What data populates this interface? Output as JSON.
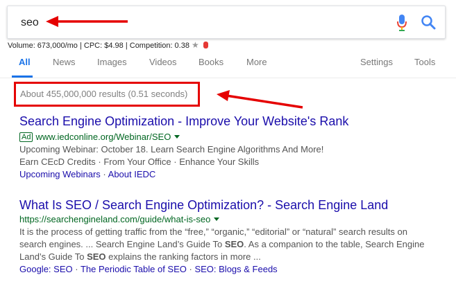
{
  "search": {
    "query": "seo"
  },
  "metrics": {
    "volume": "Volume: 673,000/mo",
    "cpc": "CPC: $4.98",
    "competition": "Competition: 0.38"
  },
  "tabs": [
    {
      "label": "All",
      "active": true
    },
    {
      "label": "News"
    },
    {
      "label": "Images"
    },
    {
      "label": "Videos"
    },
    {
      "label": "Books"
    },
    {
      "label": "More"
    },
    {
      "label": "Settings"
    },
    {
      "label": "Tools"
    }
  ],
  "result_stats": "About 455,000,000 results (0.51 seconds)",
  "results": [
    {
      "title": "Search Engine Optimization - Improve Your Website's Rank",
      "ad_label": "Ad",
      "url": "www.iedconline.org/Webinar/SEO",
      "lines": [
        "Upcoming Webinar: October 18. Learn Search Engine Algorithms And More!",
        "Earn CEcD Credits · From Your Office · Enhance Your Skills"
      ],
      "sitelinks": [
        "Upcoming Webinars",
        "About IEDC"
      ]
    },
    {
      "title": "What Is SEO / Search Engine Optimization? - Search Engine Land",
      "url": "https://searchengineland.com/guide/what-is-seo",
      "snippet": [
        "It is the process of getting traffic from the “free,” “organic,” “editorial” or “natural” search results on",
        "search engines. ... Search Engine Land’s Guide To ",
        "SEO",
        ". As a companion to the table, Search Engine",
        "Land’s Guide To ",
        "SEO",
        " explains the ranking factors in more ..."
      ],
      "sitelinks": [
        "Google: SEO",
        "The Periodic Table of SEO",
        "SEO: Blogs & Feeds"
      ]
    }
  ],
  "colors": {
    "link": "#1a0dab",
    "url": "#006621",
    "accent": "#1a73e8",
    "annotation": "#e50000"
  }
}
